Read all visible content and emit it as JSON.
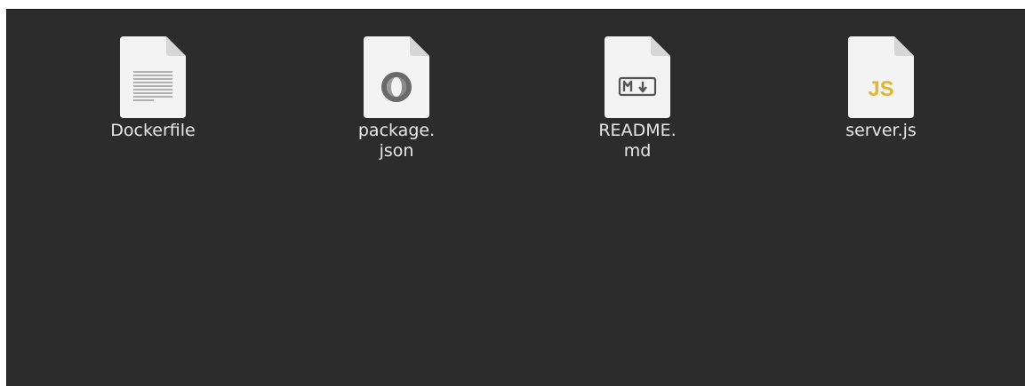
{
  "files": [
    {
      "name": "Dockerfile",
      "line1": "Dockerfile",
      "line2": "",
      "icon": "text-file-icon"
    },
    {
      "name": "package.json",
      "line1": "package.",
      "line2": "json",
      "icon": "json-file-icon"
    },
    {
      "name": "README.md",
      "line1": "README.",
      "line2": "md",
      "icon": "markdown-file-icon"
    },
    {
      "name": "server.js",
      "line1": "server.js",
      "line2": "",
      "icon": "javascript-file-icon"
    }
  ],
  "colors": {
    "background": "#2c2c2c",
    "text": "#e8e8e8",
    "js_accent": "#e6b62a"
  }
}
